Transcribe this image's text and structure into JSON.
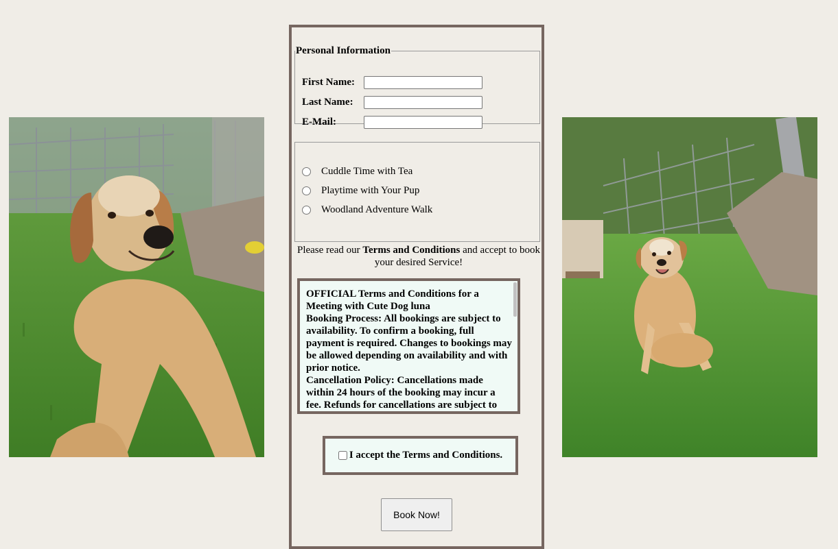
{
  "personal": {
    "legend": "Personal Information",
    "fields": [
      {
        "label": "First Name:",
        "value": ""
      },
      {
        "label": "Last Name:",
        "value": ""
      },
      {
        "label": "E-Mail:",
        "value": ""
      }
    ]
  },
  "services": {
    "options": [
      "Cuddle Time with Tea",
      "Playtime with Your Pup",
      "Woodland Adventure Walk"
    ]
  },
  "terms_intro": {
    "before": "Please read our ",
    "bold": "Terms and Conditions",
    "after": " and accept to book your desired Service!"
  },
  "terms": {
    "paragraphs": [
      "OFFICIAL Terms and Conditions for a Meeting with Cute Dog luna",
      "Booking Process: All bookings are subject to availability. To confirm a booking, full payment is required. Changes to bookings may be allowed depending on availability and with prior notice.",
      "Cancellation Policy: Cancellations made within 24 hours of the booking may incur a fee. Refunds for cancellations are subject to"
    ]
  },
  "accept": {
    "label": "I accept the Terms and Conditions."
  },
  "book_button": "Book Now!",
  "colors": {
    "background": "#f0ede7",
    "frame_border": "#766660",
    "terms_background": "#f0faf6"
  }
}
